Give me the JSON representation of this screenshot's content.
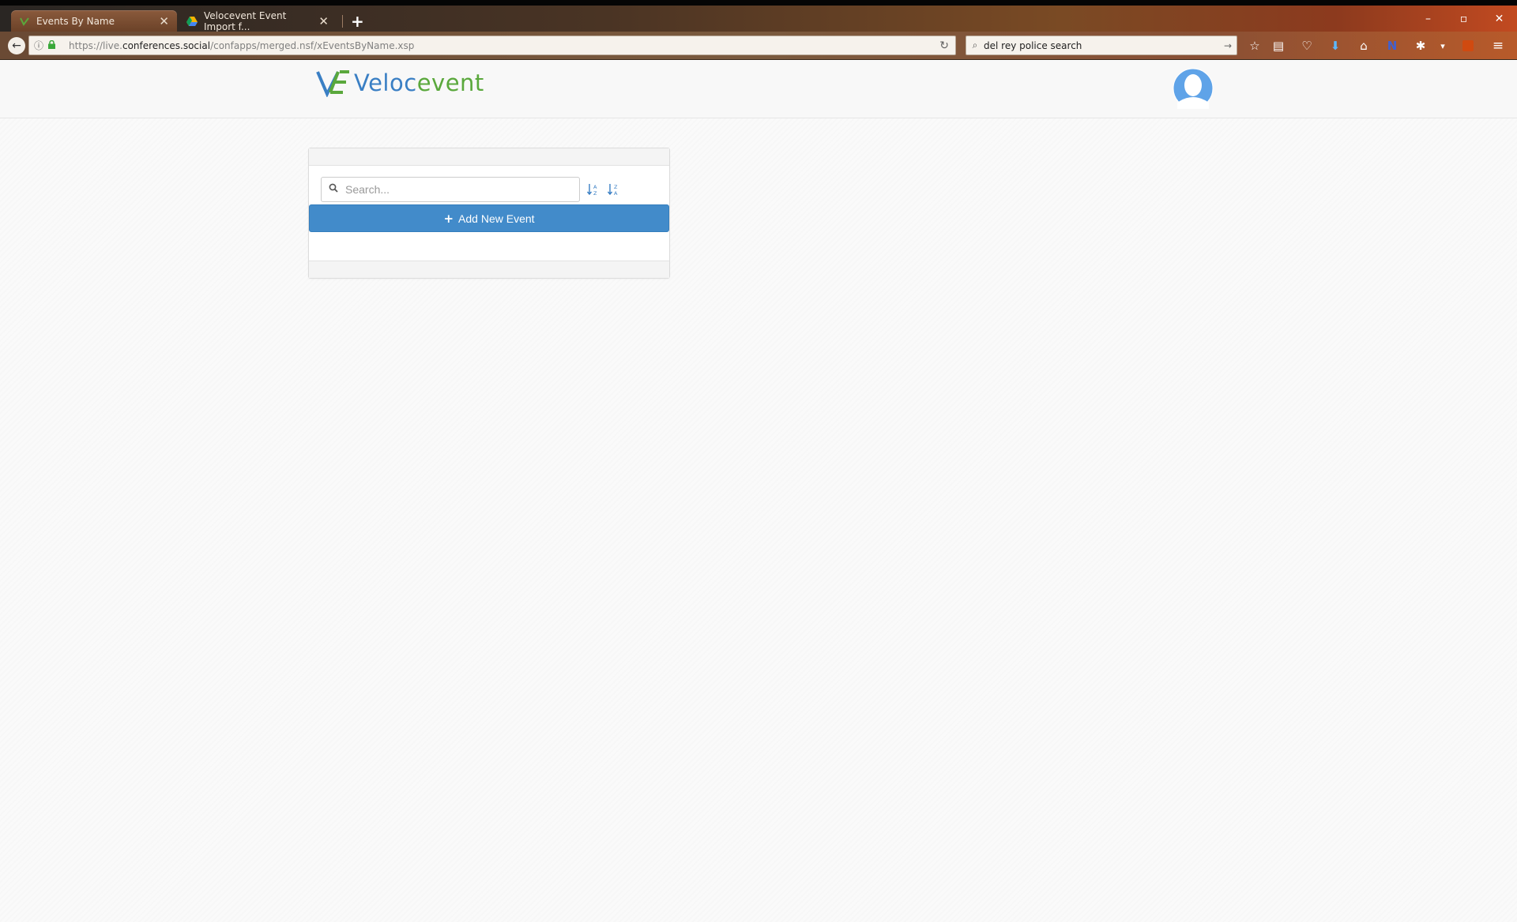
{
  "browser": {
    "tabs": [
      {
        "label": "Events By Name",
        "active": true
      },
      {
        "label": "Velocevent Event Import f...",
        "active": false
      }
    ],
    "new_tab_symbol": "+",
    "url": {
      "prefix": "https://live.",
      "domain": "conferences.social",
      "path": "/confapps/merged.nsf/xEventsByName.xsp"
    },
    "search_value": "del rey police search",
    "window_controls": [
      "–",
      "▫",
      "✕"
    ]
  },
  "app": {
    "logo_text_part1": "Veloc",
    "logo_text_part2": "event",
    "brand_colors": {
      "blue": "#3a7fc4",
      "green": "#5aa83c"
    }
  },
  "events_panel": {
    "search_placeholder": "Search...",
    "sort_asc_icon": "sort-alpha-asc-icon",
    "sort_desc_icon": "sort-alpha-desc-icon",
    "add_button_label": "Add New Event",
    "add_button_color": "#428bca"
  }
}
